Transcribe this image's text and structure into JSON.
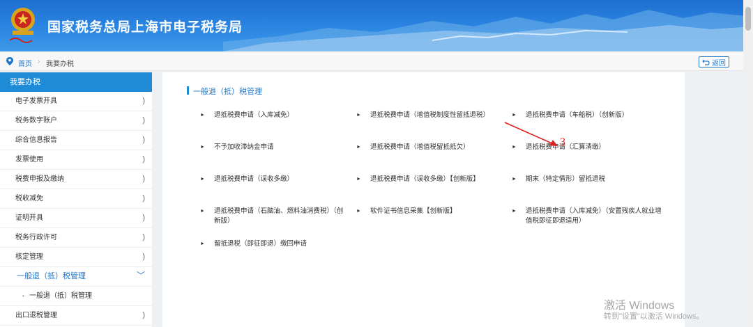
{
  "header": {
    "title": "国家税务总局上海市电子税务局"
  },
  "breadcrumb": {
    "home": "首页",
    "separator": "›",
    "current": "我要办税",
    "back_label": "返回"
  },
  "sidebar": {
    "heading": "我要办税",
    "items": [
      {
        "label": "电子发票开具"
      },
      {
        "label": "税务数字账户"
      },
      {
        "label": "综合信息报告"
      },
      {
        "label": "发票使用"
      },
      {
        "label": "税费申报及缴纳"
      },
      {
        "label": "税收减免"
      },
      {
        "label": "证明开具"
      },
      {
        "label": "税务行政许可"
      },
      {
        "label": "核定管理"
      }
    ],
    "active_item": "一般退（抵）税管理",
    "sub_item": "一般退（抵）税管理",
    "last_item": "出口退税管理",
    "chevron": ")",
    "chevron_down": "﹀"
  },
  "main": {
    "section_title": "一般退（抵）税管理",
    "links": [
      {
        "label": "退抵税费申请（入库减免）"
      },
      {
        "label": "退抵税费申请（增值税制度性留抵退税）"
      },
      {
        "label": "退抵税费申请（车船税）（创新版）"
      },
      {
        "label": "不予加收滞纳金申请"
      },
      {
        "label": "退抵税费申请（增值税留抵抵欠）"
      },
      {
        "label": "退抵税费申请（汇算清缴）"
      },
      {
        "label": "退抵税费申请（误收多缴）"
      },
      {
        "label": "退抵税费申请（误收多缴）【创新版】"
      },
      {
        "label": "期末（特定情形）留抵退税"
      },
      {
        "label": "退抵税费申请（石脑油、燃料油消费税）（创新版）"
      },
      {
        "label": "软件证书信息采集【创新版】"
      },
      {
        "label": "退抵税费申请（入库减免）（安置残疾人就业增值税即征即退适用）"
      },
      {
        "label": "留抵退税（即征即退）缴回申请"
      }
    ]
  },
  "annotation": {
    "number": "3",
    "color": "#e02020"
  },
  "watermark": {
    "line1": "激活 Windows",
    "line2": "转到\"设置\"以激活 Windows。"
  },
  "colors": {
    "accent": "#1f8ad6",
    "link": "#1f76c9"
  }
}
